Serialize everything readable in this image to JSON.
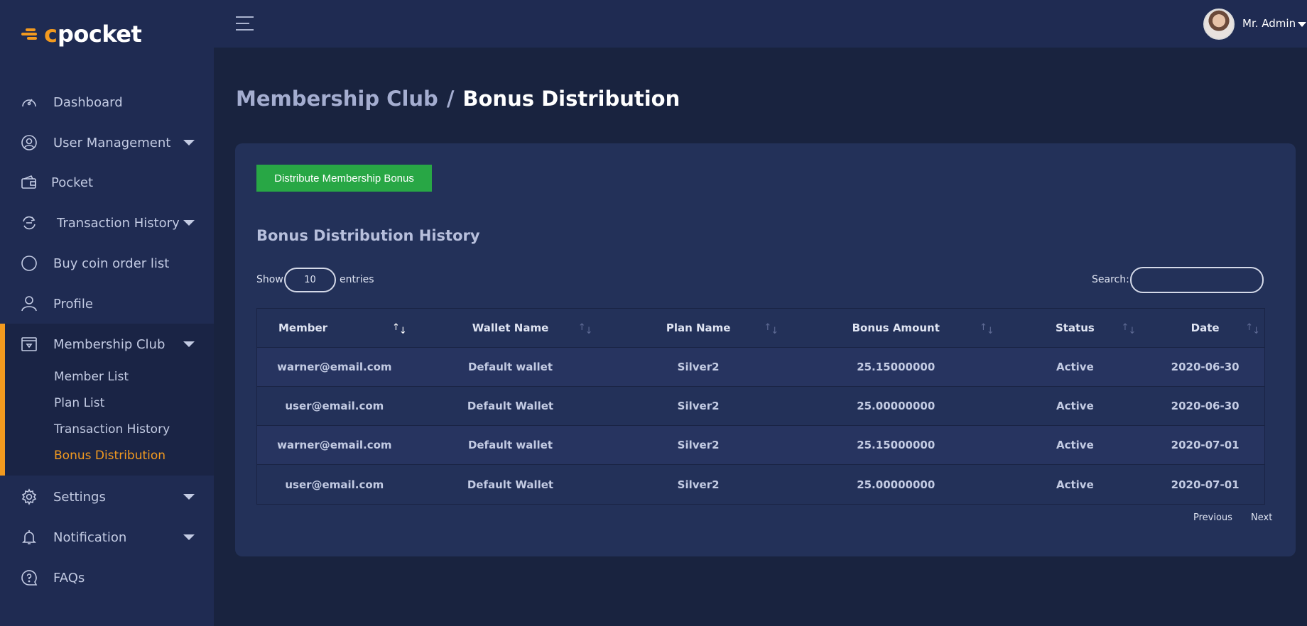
{
  "brand": {
    "logo_c": "c",
    "logo_text": "pocket"
  },
  "sidebar": {
    "items": [
      {
        "label": "Dashboard",
        "icon": "speedometer-icon"
      },
      {
        "label": "User Management",
        "icon": "user-circle-icon"
      },
      {
        "label": "Pocket",
        "icon": "wallet-icon"
      },
      {
        "label": "Transaction History",
        "icon": "exchange-icon"
      },
      {
        "label": "Buy coin order list",
        "icon": "circle-icon"
      },
      {
        "label": "Profile",
        "icon": "user-icon"
      },
      {
        "label": "Membership Club",
        "icon": "membership-card-icon"
      },
      {
        "label": "Settings",
        "icon": "gear-icon"
      },
      {
        "label": "Notification",
        "icon": "bell-icon"
      },
      {
        "label": "FAQs",
        "icon": "question-icon"
      }
    ],
    "submenu": [
      "Member List",
      "Plan List",
      "Transaction History",
      "Bonus Distribution"
    ]
  },
  "topbar": {
    "user_name": "Mr. Admin"
  },
  "breadcrumb": {
    "parent": "Membership Club",
    "separator": "/",
    "current": "Bonus Distribution"
  },
  "card": {
    "button_label": "Distribute Membership Bonus",
    "section_title": "Bonus Distribution History",
    "show_label": "Show",
    "entries_value": "10",
    "entries_label": "entries",
    "search_label": "Search:",
    "search_value": ""
  },
  "table": {
    "headers": [
      "Member",
      "Wallet Name",
      "Plan Name",
      "Bonus Amount",
      "Status",
      "Date"
    ],
    "rows": [
      [
        "warner@email.com",
        "Default wallet",
        "Silver2",
        "25.15000000",
        "Active",
        "2020-06-30"
      ],
      [
        "user@email.com",
        "Default Wallet",
        "Silver2",
        "25.00000000",
        "Active",
        "2020-06-30"
      ],
      [
        "warner@email.com",
        "Default wallet",
        "Silver2",
        "25.15000000",
        "Active",
        "2020-07-01"
      ],
      [
        "user@email.com",
        "Default Wallet",
        "Silver2",
        "25.00000000",
        "Active",
        "2020-07-01"
      ]
    ]
  },
  "pagination": {
    "previous": "Previous",
    "next": "Next"
  },
  "colors": {
    "accent": "#f39a1f",
    "success": "#28a745",
    "sidebar_bg": "#1f2b52",
    "page_bg": "#19233f"
  }
}
